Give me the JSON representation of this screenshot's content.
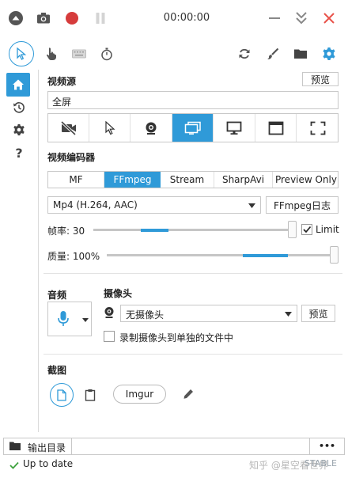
{
  "titlebar": {
    "timer": "00:00:00"
  },
  "icons": {
    "collapse": "chevron-up-circle-icon",
    "screenshot": "camera-icon",
    "record": "record-icon",
    "pause": "pause-icon",
    "minimize": "minimize-icon",
    "tray": "double-chevron-down-icon",
    "close": "close-icon"
  },
  "colors": {
    "accent": "#2f9ad8",
    "record": "#d63c3c",
    "close": "#e8524a",
    "status_ok": "#3aa03a"
  },
  "video_source": {
    "label": "视频源",
    "preview_button": "预览",
    "current_value": "全屏"
  },
  "video_encoder": {
    "label": "视频编码器",
    "tabs": [
      "MF",
      "FFmpeg",
      "Stream",
      "SharpAvi",
      "Preview Only"
    ],
    "selected_tab": "FFmpeg",
    "format_value": "Mp4 (H.264, AAC)",
    "log_button": "FFmpeg日志",
    "framerate_label": "帧率: 30",
    "framerate_value": 30,
    "limit_label": "Limit",
    "limit_checked": true,
    "quality_label": "质量: 100%",
    "quality_value": 100
  },
  "audio": {
    "label": "音频"
  },
  "webcam": {
    "label": "摄像头",
    "selected": "无摄像头",
    "preview_button": "预览",
    "separate_file_label": "录制摄像头到单独的文件中",
    "separate_file_checked": false
  },
  "screenshot": {
    "label": "截图",
    "imgur_button": "Imgur"
  },
  "output": {
    "folder_label": "输出目录",
    "path_value": "",
    "more_button": "•••"
  },
  "status": {
    "text": "Up to date",
    "watermark": "知乎 @星空看世界",
    "build": "STABLE"
  }
}
